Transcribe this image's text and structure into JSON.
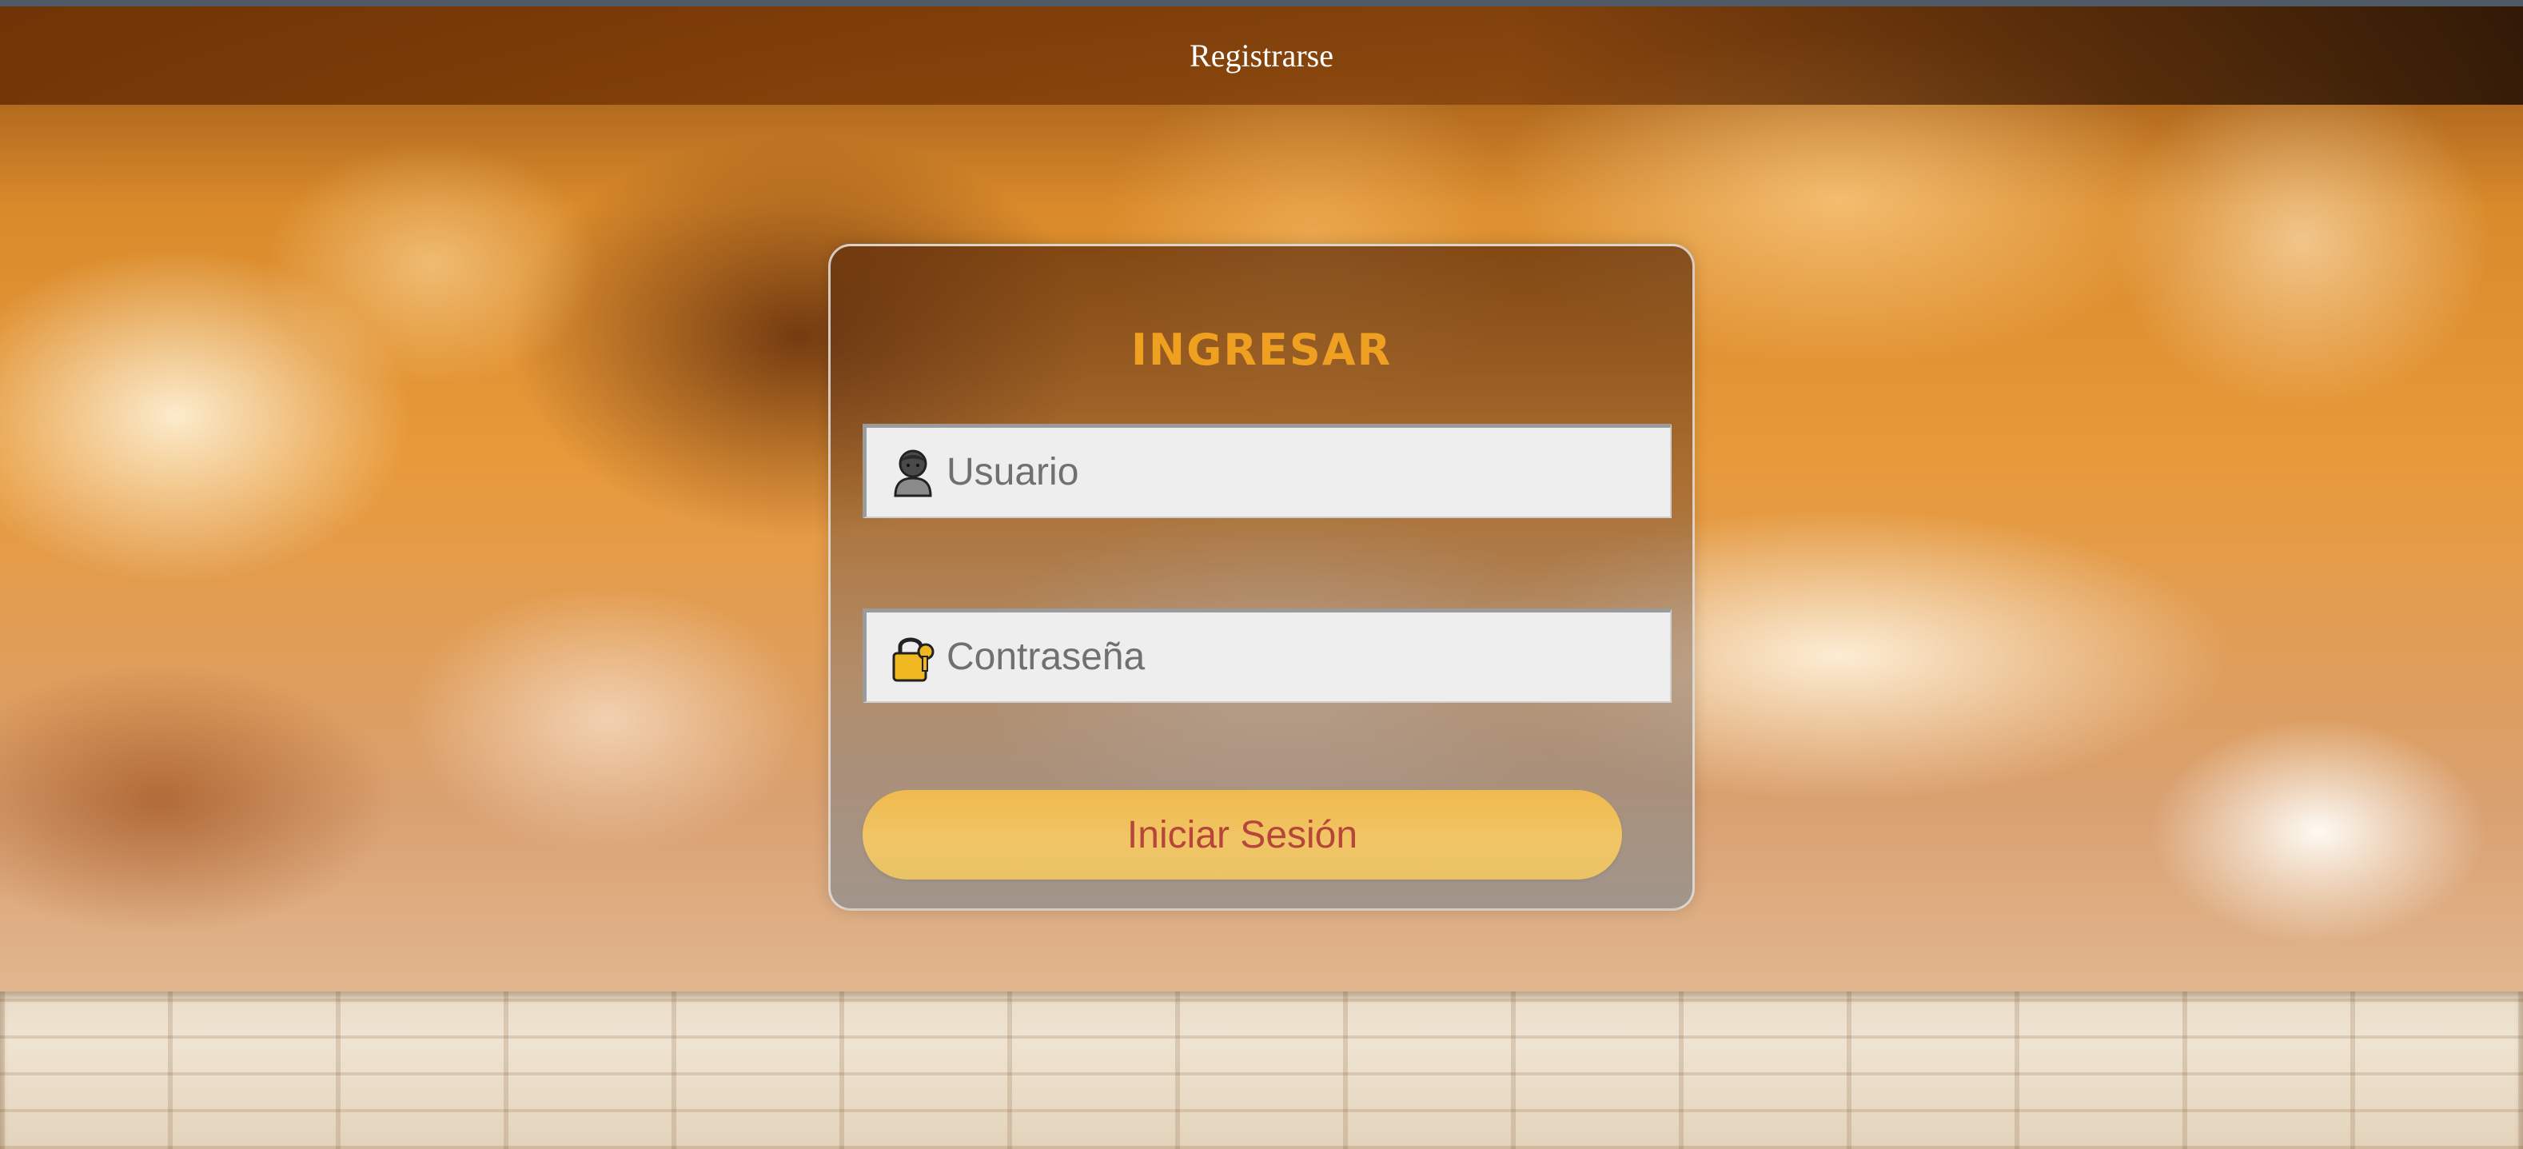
{
  "nav": {
    "register_label": "Registrarse"
  },
  "login": {
    "title": "INGRESAR",
    "username": {
      "placeholder": "Usuario",
      "value": "",
      "icon": "user-icon"
    },
    "password": {
      "placeholder": "Contraseña",
      "value": "",
      "icon": "lock-key-icon"
    },
    "submit_label": "Iniciar Sesión"
  },
  "colors": {
    "title": "#f0a020",
    "button_bg": "#f1c565",
    "button_text": "#b8453a",
    "navbar": "#7a3a08"
  }
}
